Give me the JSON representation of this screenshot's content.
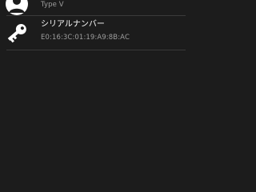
{
  "items": [
    {
      "icon": "person-icon",
      "title": "",
      "subtitle": "Type V"
    },
    {
      "icon": "key-icon",
      "title": "シリアルナンバー",
      "subtitle": "E0:16:3C:01:19:A9:8B:AC"
    }
  ],
  "colors": {
    "background": "#1c1c1c",
    "primary_text": "#ffffff",
    "secondary_text": "#9e9e9e",
    "divider": "#3a3a3a"
  }
}
